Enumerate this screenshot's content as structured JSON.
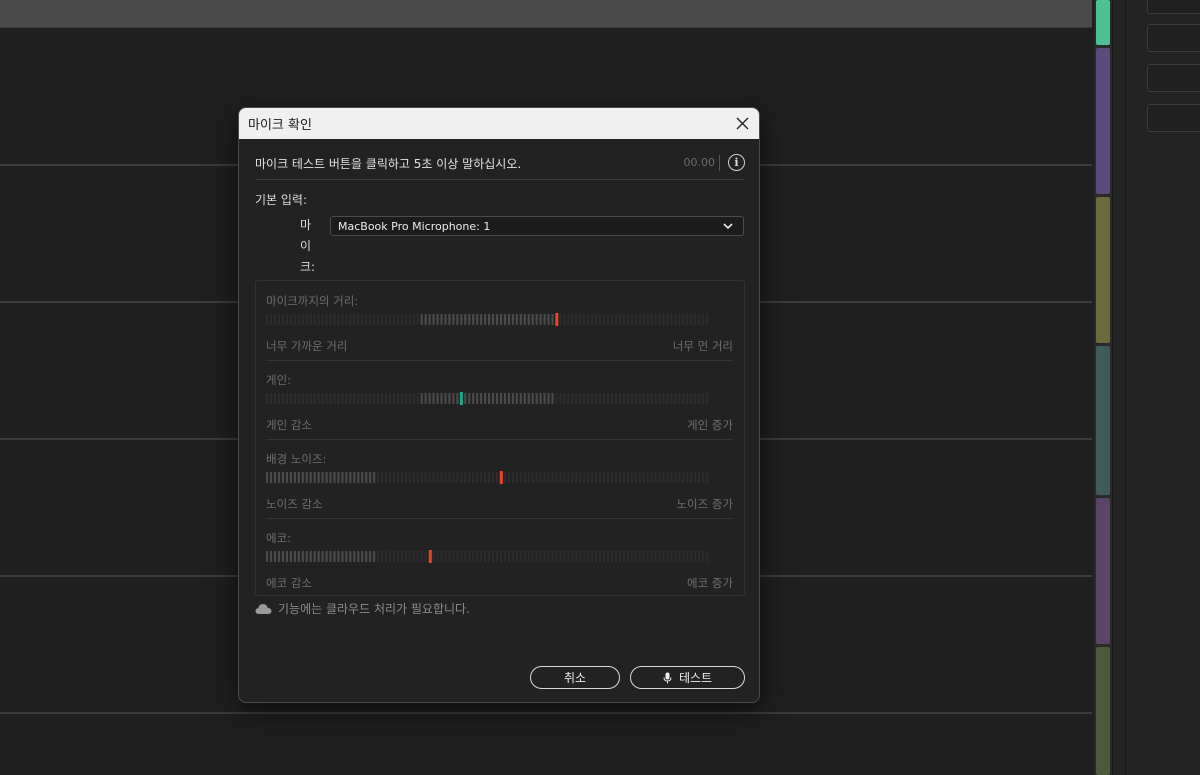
{
  "dialog": {
    "title": "마이크 확인",
    "instruction": "마이크 테스트 버튼을 클릭하고 5초 이상 말하십시오.",
    "timer": "00.00",
    "info_icon": "info-icon",
    "basic_input_label": "기본 입력:",
    "mic_label": "마이크:",
    "mic_selected": "MacBook Pro Microphone: 1",
    "cloud_note": "기능에는 클라우드 처리가 필요합니다.",
    "cancel_label": "취소",
    "test_label": "테스트"
  },
  "meters": [
    {
      "id": "distance",
      "label": "마이크까지의 거리:",
      "low": "너무 가까운 거리",
      "high": "너무 먼 거리",
      "indicator": 0.655,
      "indicator_color": "#e8452b",
      "range": [
        0.35,
        0.65
      ]
    },
    {
      "id": "gain",
      "label": "게인:",
      "low": "게인 감소",
      "high": "게인 증가",
      "indicator": 0.44,
      "indicator_color": "#17b08a",
      "range": [
        0.35,
        0.65
      ]
    },
    {
      "id": "noise",
      "label": "배경 노이즈:",
      "low": "노이즈 감소",
      "high": "노이즈 증가",
      "indicator": 0.53,
      "indicator_color": "#e8452b",
      "range": [
        0.0,
        0.25
      ]
    },
    {
      "id": "echo",
      "label": "에코:",
      "low": "에코 감소",
      "high": "에코 증가",
      "indicator": 0.37,
      "indicator_color": "#e8452b",
      "range": [
        0.0,
        0.25
      ]
    }
  ],
  "colors": {
    "titlebar_bg": "#f0f0f0",
    "dialog_bg": "#222222",
    "tick_active": "#4a4a4a",
    "tick_inactive": "#2c2c2c"
  },
  "track_colors": [
    "#4fbf94",
    "#5a4b7a",
    "#6b6a3a",
    "#3f5a5a",
    "#5a4569",
    "#4a5a3a"
  ]
}
